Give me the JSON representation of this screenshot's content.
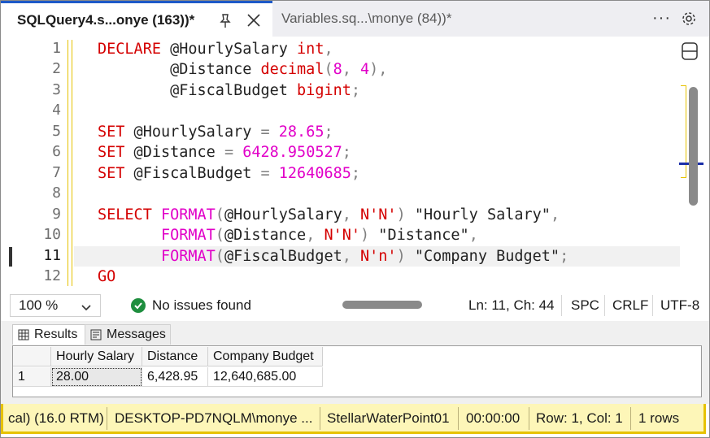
{
  "tabs": [
    {
      "label": "SQLQuery4.s...onye (163))*",
      "active": true
    },
    {
      "label": "Variables.sq...\\monye (84))*",
      "active": false
    }
  ],
  "tab_actions": {
    "more": "···"
  },
  "editor": {
    "line_numbers": [
      "1",
      "2",
      "3",
      "4",
      "5",
      "6",
      "7",
      "8",
      "9",
      "10",
      "11",
      "12"
    ],
    "current_line": 11
  },
  "status": {
    "zoom": "100 %",
    "issues": "No issues found",
    "position": "Ln: 11, Ch: 44",
    "whitespace": "SPC",
    "line_ending": "CRLF",
    "encoding": "UTF-8"
  },
  "results": {
    "tabs": [
      "Results",
      "Messages"
    ],
    "columns": [
      "Hourly Salary",
      "Distance",
      "Company Budget"
    ],
    "rows": [
      {
        "num": "1",
        "cells": [
          "28.00",
          "6,428.95",
          "12,640,685.00"
        ]
      }
    ]
  },
  "bottom_bar": {
    "version": "cal) (16.0 RTM)",
    "server": "DESKTOP-PD7NQLM\\monye ...",
    "database": "StellarWaterPoint01",
    "elapsed": "00:00:00",
    "rowcol": "Row: 1, Col: 1",
    "rows": "1 rows"
  },
  "colors": {
    "keyword": "#d40000",
    "function": "#e100c8",
    "number": "#e100c8",
    "status_bar": "#fdf6b8",
    "tab_accent": "#1e5ac8"
  }
}
